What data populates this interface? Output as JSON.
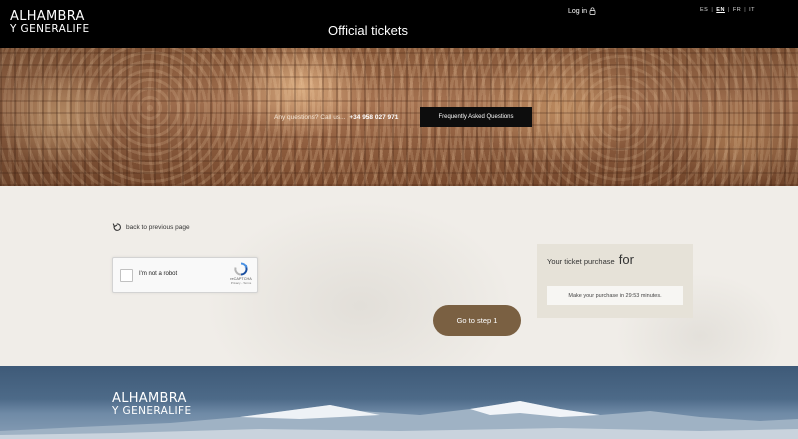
{
  "header": {
    "logo_line1": "ALHAMBRA",
    "logo_line2": "Y GENERALIFE",
    "title": "Official tickets",
    "login_label": "Log in",
    "login_icon": "lock-icon",
    "languages": [
      {
        "code": "ES",
        "active": false
      },
      {
        "code": "EN",
        "active": true
      },
      {
        "code": "FR",
        "active": false
      },
      {
        "code": "IT",
        "active": false
      }
    ]
  },
  "hero": {
    "contact_text": "Any questions? Call us...",
    "phone": "+34 958 027 971",
    "faq_button": "Frequently Asked Questions"
  },
  "main": {
    "back_link": "back to previous page",
    "back_icon": "back-arrow-icon",
    "recaptcha": {
      "label": "I'm not a robot",
      "brand": "reCAPTCHA",
      "terms": "Privacy - Terms"
    },
    "go_button": "Go to step 1",
    "purchase": {
      "title": "Your ticket purchase",
      "title_suffix": "for",
      "timer_text": "Make your purchase in 29:53 minutes."
    }
  },
  "footer": {
    "logo_line1": "ALHAMBRA",
    "logo_line2": "Y GENERALIFE"
  },
  "colors": {
    "header_bg": "#000000",
    "button_brown": "#7a6042",
    "content_bg": "#f0ede8",
    "purchase_box": "#e6e2d8"
  }
}
